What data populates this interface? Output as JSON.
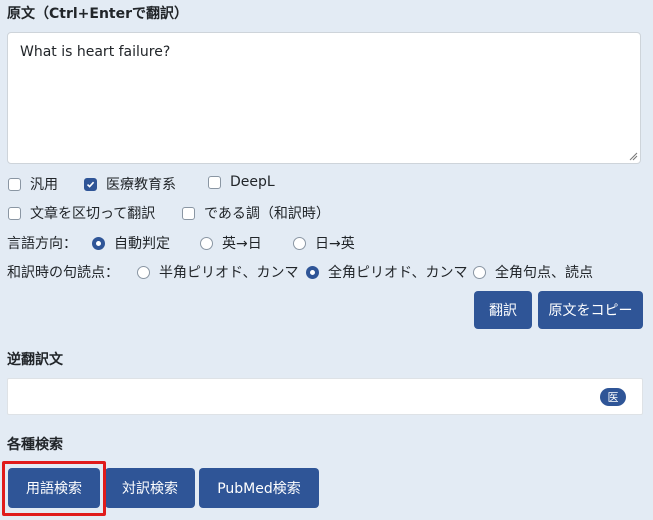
{
  "source": {
    "title": "原文（Ctrl+Enterで翻訳）",
    "text": "What is heart failure?"
  },
  "options_row1": [
    {
      "label": "汎用",
      "checked": false
    },
    {
      "label": "医療教育系",
      "checked": true
    },
    {
      "label": "DeepL",
      "checked": false
    }
  ],
  "options_row2": [
    {
      "label": "文章を区切って翻訳",
      "checked": false
    },
    {
      "label": "である調（和訳時）",
      "checked": false
    }
  ],
  "direction": {
    "label": "言語方向：",
    "options": [
      {
        "label": "自動判定",
        "selected": true
      },
      {
        "label": "英→日",
        "selected": false
      },
      {
        "label": "日→英",
        "selected": false
      }
    ]
  },
  "punctuation": {
    "label": "和訳時の句読点：",
    "options": [
      {
        "label": "半角ピリオド、カンマ",
        "selected": false
      },
      {
        "label": "全角ピリオド、カンマ",
        "selected": true
      },
      {
        "label": "全角句点、読点",
        "selected": false
      }
    ]
  },
  "actions": {
    "translate": "翻訳",
    "copy_source": "原文をコピー"
  },
  "back_translation": {
    "title": "逆翻訳文",
    "badge": "医"
  },
  "search": {
    "title": "各種検索",
    "term_search": "用語検索",
    "parallel_search": "対訳検索",
    "pubmed_search": "PubMed検索"
  },
  "colors": {
    "accent": "#2f5597",
    "highlight": "#e01b1b",
    "background": "#e3ebf4"
  }
}
